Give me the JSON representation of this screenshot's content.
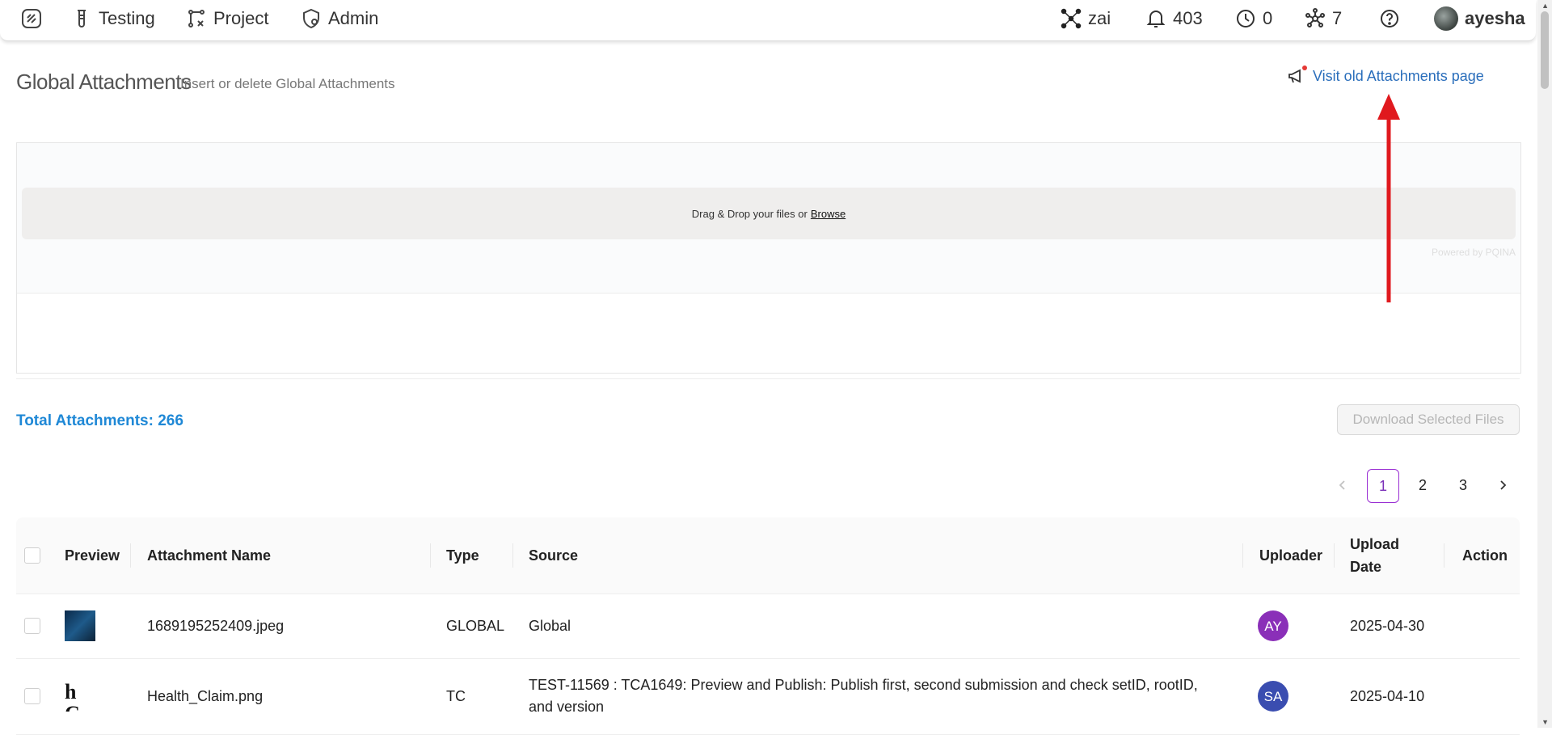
{
  "nav": {
    "testing": "Testing",
    "project": "Project",
    "admin": "Admin",
    "zai": "zai",
    "notifications": "403",
    "clock_count": "0",
    "graph_count": "7",
    "username": "ayesha"
  },
  "header": {
    "title": "Global Attachments",
    "subtitle": "Insert or delete Global Attachments",
    "old_link": "Visit old Attachments page"
  },
  "upload": {
    "prompt": "Drag & Drop your files or",
    "browse": "Browse",
    "powered": "Powered by PQINA"
  },
  "summary": {
    "total": "Total Attachments: 266",
    "download_button": "Download Selected Files"
  },
  "pagination": {
    "pages": [
      "1",
      "2",
      "3"
    ],
    "current": "1"
  },
  "table": {
    "headers": {
      "preview": "Preview",
      "name": "Attachment Name",
      "type": "Type",
      "source": "Source",
      "uploader": "Uploader",
      "upload_date_line1": "Upload",
      "upload_date_line2": "Date",
      "action": "Action"
    },
    "rows": [
      {
        "name": "1689195252409.jpeg",
        "type": "GLOBAL",
        "source": "Global",
        "uploader_initials": "AY",
        "uploader_color": "#8a2fb8",
        "date": "2025-04-30",
        "thumb_text": ""
      },
      {
        "name": "Health_Claim.png",
        "type": "TC",
        "source": "TEST-11569 : TCA1649: Preview and Publish: Publish first, second submission and check setID, rootID, and version",
        "uploader_initials": "SA",
        "uploader_color": "#3a4db0",
        "date": "2025-04-10",
        "thumb_text": "h C"
      }
    ]
  },
  "colors": {
    "link": "#2a6ebb",
    "total": "#1f88d6",
    "pagination_active": "#9a2fd3",
    "annotation_arrow": "#e0191e"
  }
}
